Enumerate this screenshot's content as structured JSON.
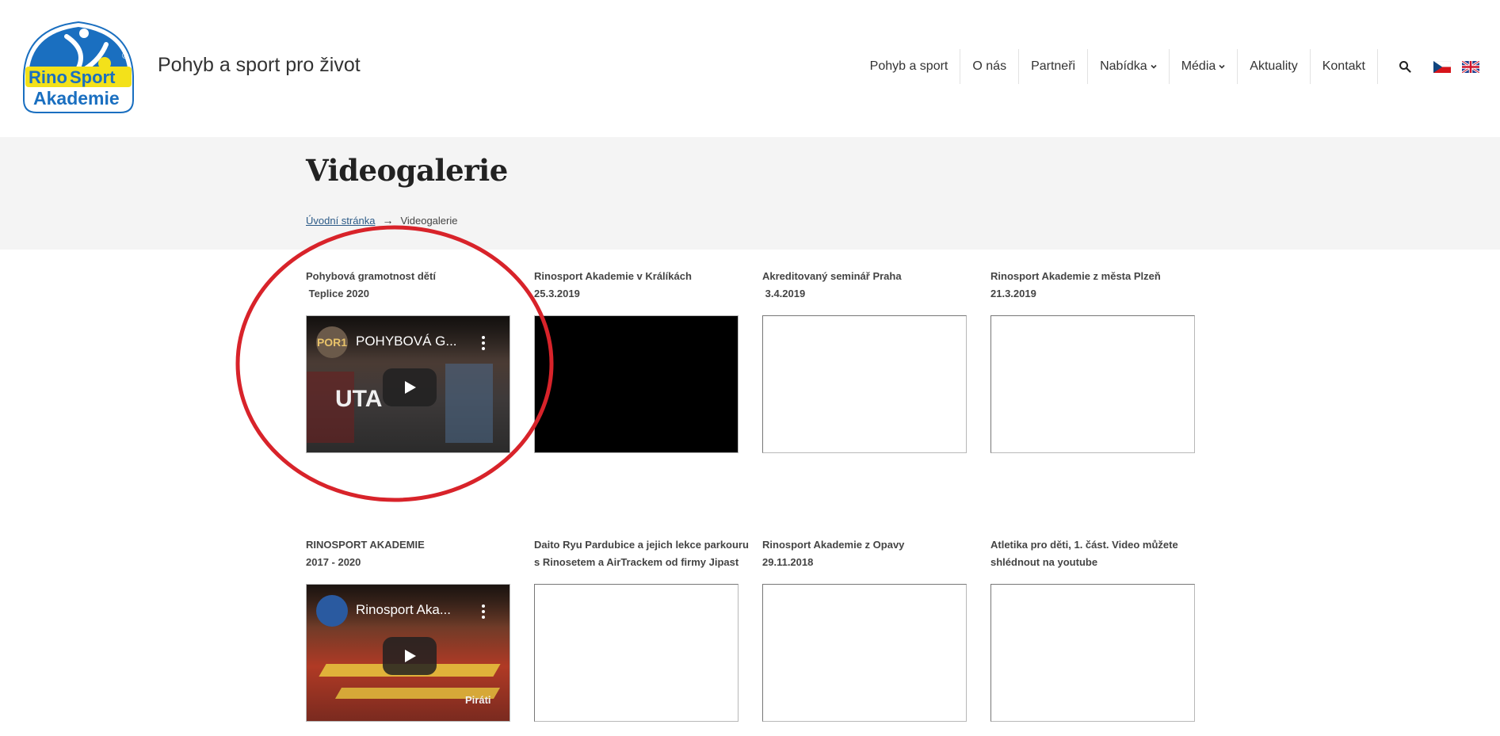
{
  "header": {
    "logo": {
      "brand_line1": "Rino",
      "brand_line2": "Sport",
      "brand_line3": "Akademie",
      "mark": "®"
    },
    "tagline": "Pohyb a sport pro život"
  },
  "nav": {
    "items": [
      {
        "label": "Pohyb a sport",
        "dropdown": false
      },
      {
        "label": "O nás",
        "dropdown": false
      },
      {
        "label": "Partneři",
        "dropdown": false
      },
      {
        "label": "Nabídka",
        "dropdown": true
      },
      {
        "label": "Média",
        "dropdown": true
      },
      {
        "label": "Aktuality",
        "dropdown": false
      },
      {
        "label": "Kontakt",
        "dropdown": false
      }
    ],
    "search_icon": "search-icon",
    "languages": [
      "cs",
      "en"
    ]
  },
  "page": {
    "title": "Videogalerie",
    "breadcrumb": {
      "home": "Úvodní stránka",
      "arrow": "→",
      "current": "Videogalerie"
    }
  },
  "videos": [
    {
      "title": "Pohybová gramotnost dětí\n Teplice 2020",
      "state": "thumbnail",
      "yt_title": "POHYBOVÁ G...",
      "avatar_text": "POR1",
      "overlay_text": "UTA"
    },
    {
      "title": "Rinosport Akademie v Králíkách\n25.3.2019",
      "state": "black"
    },
    {
      "title": "Akreditovaný seminář Praha\n 3.4.2019",
      "state": "blank"
    },
    {
      "title": "Rinosport Akademie z města Plzeň\n21.3.2019",
      "state": "blank"
    },
    {
      "title": "RINOSPORT AKADEMIE\n2017 - 2020",
      "state": "thumbnail",
      "yt_title": "Rinosport Aka...",
      "avatar_text": "",
      "overlay_text": "Piráti"
    },
    {
      "title": "Daito Ryu Pardubice a jejich lekce parkouru\ns Rinosetem a AirTrackem od firmy Jipast",
      "state": "blank"
    },
    {
      "title": "Rinosport Akademie z Opavy\n29.11.2018",
      "state": "blank"
    },
    {
      "title": "Atletika pro děti, 1. část. Video můžete\nshlédnout na youtube",
      "state": "blank"
    }
  ],
  "colors": {
    "logo_blue": "#1a6fc0",
    "logo_yellow": "#f3e11a",
    "title_band": "#f4f4f4",
    "breadcrumb_link": "#2b5a87",
    "highlight": "#d8232a"
  }
}
